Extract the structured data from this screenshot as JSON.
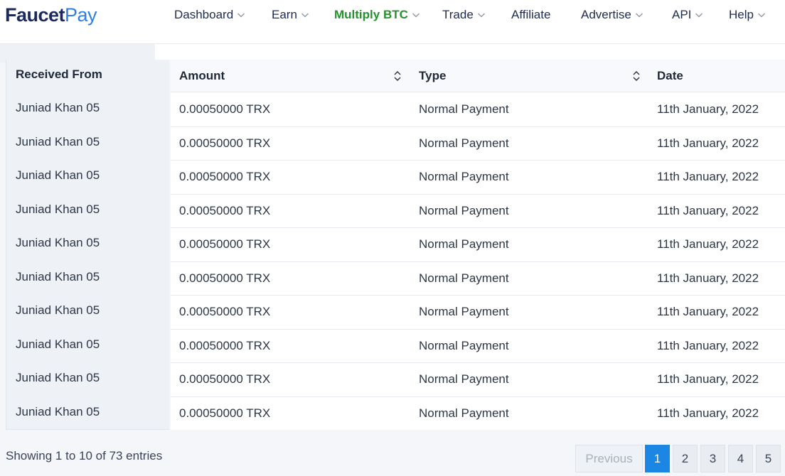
{
  "logo": {
    "part1": "Faucet",
    "part2": "Pay"
  },
  "nav": [
    {
      "label": "Dashboard",
      "has_dropdown": true
    },
    {
      "label": "Earn",
      "has_dropdown": true
    },
    {
      "label": "Multiply BTC",
      "has_dropdown": true,
      "active": true
    },
    {
      "label": "Trade",
      "has_dropdown": true
    },
    {
      "label": "Affiliate",
      "has_dropdown": false
    },
    {
      "label": "Advertise",
      "has_dropdown": true
    },
    {
      "label": "API",
      "has_dropdown": true
    },
    {
      "label": "Help",
      "has_dropdown": true
    }
  ],
  "table": {
    "columns": [
      "Received From",
      "Amount",
      "Type",
      "Date"
    ],
    "rows": [
      [
        "Juniad Khan 05",
        "0.00050000 TRX",
        "Normal Payment",
        "11th January, 2022"
      ],
      [
        "Juniad Khan 05",
        "0.00050000 TRX",
        "Normal Payment",
        "11th January, 2022"
      ],
      [
        "Juniad Khan 05",
        "0.00050000 TRX",
        "Normal Payment",
        "11th January, 2022"
      ],
      [
        "Juniad Khan 05",
        "0.00050000 TRX",
        "Normal Payment",
        "11th January, 2022"
      ],
      [
        "Juniad Khan 05",
        "0.00050000 TRX",
        "Normal Payment",
        "11th January, 2022"
      ],
      [
        "Juniad Khan 05",
        "0.00050000 TRX",
        "Normal Payment",
        "11th January, 2022"
      ],
      [
        "Juniad Khan 05",
        "0.00050000 TRX",
        "Normal Payment",
        "11th January, 2022"
      ],
      [
        "Juniad Khan 05",
        "0.00050000 TRX",
        "Normal Payment",
        "11th January, 2022"
      ],
      [
        "Juniad Khan 05",
        "0.00050000 TRX",
        "Normal Payment",
        "11th January, 2022"
      ],
      [
        "Juniad Khan 05",
        "0.00050000 TRX",
        "Normal Payment",
        "11th January, 2022"
      ]
    ]
  },
  "footer": {
    "info": "Showing 1 to 10 of 73 entries",
    "pagination": {
      "previous_label": "Previous",
      "pages": [
        "1",
        "2",
        "3",
        "4",
        "5"
      ],
      "current_page": "1"
    }
  },
  "colors": {
    "brand_dark": "#1b2a5e",
    "brand_blue": "#2f7fe0",
    "nav_active": "#23912d",
    "pager_active": "#1b86e3"
  }
}
